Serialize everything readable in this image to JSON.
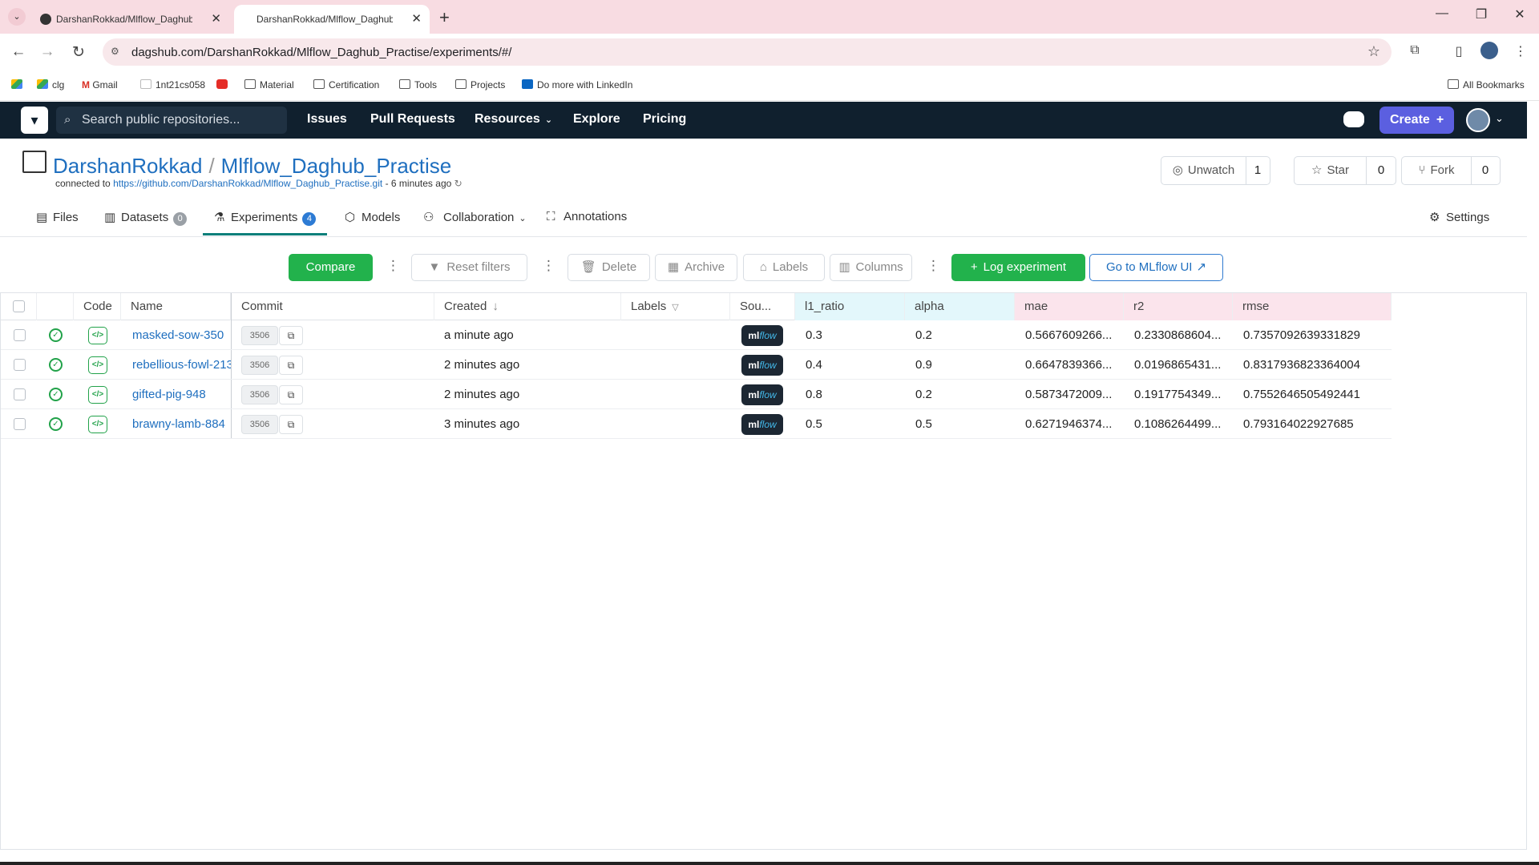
{
  "browser": {
    "tabs": [
      {
        "title": "DarshanRokkad/Mlflow_Daghub_P",
        "active": false
      },
      {
        "title": "DarshanRokkad/Mlflow_Daghub_P",
        "active": true
      }
    ],
    "url": "dagshub.com/DarshanRokkad/Mlflow_Daghub_Practise/experiments/#/",
    "bookmarks": [
      {
        "label": "",
        "icon": "drive-icon"
      },
      {
        "label": "clg",
        "icon": "drive-icon"
      },
      {
        "label": "Gmail",
        "icon": "gmail-icon"
      },
      {
        "label": "1nt21cs058",
        "icon": "bookmark-icon"
      },
      {
        "label": "",
        "icon": "youtube-icon"
      },
      {
        "label": "Material",
        "icon": "folder-icon"
      },
      {
        "label": "Certification",
        "icon": "folder-icon"
      },
      {
        "label": "Tools",
        "icon": "folder-icon"
      },
      {
        "label": "Projects",
        "icon": "folder-icon"
      },
      {
        "label": "Do more with LinkedIn",
        "icon": "linkedin-icon"
      }
    ],
    "all_bookmarks": "All Bookmarks"
  },
  "dagshub": {
    "search_placeholder": "Search public repositories...",
    "nav": [
      "Issues",
      "Pull Requests",
      "Resources",
      "Explore",
      "Pricing"
    ],
    "create_label": "Create"
  },
  "repo": {
    "owner": "DarshanRokkad",
    "name": "Mlflow_Daghub_Practise",
    "connected_prefix": "connected to",
    "connected_url": "https://github.com/DarshanRokkad/Mlflow_Daghub_Practise.git",
    "connected_time": "- 6 minutes ago",
    "watch": {
      "label": "Unwatch",
      "count": "1"
    },
    "star": {
      "label": "Star",
      "count": "0"
    },
    "fork": {
      "label": "Fork",
      "count": "0"
    },
    "tabs": [
      {
        "label": "Files",
        "icon": "file-icon",
        "badge": ""
      },
      {
        "label": "Datasets",
        "icon": "database-icon",
        "badge": "0"
      },
      {
        "label": "Experiments",
        "icon": "flask-icon",
        "badge": "4"
      },
      {
        "label": "Models",
        "icon": "cube-icon",
        "badge": ""
      },
      {
        "label": "Collaboration",
        "icon": "people-icon",
        "badge": ""
      },
      {
        "label": "Annotations",
        "icon": "annotation-icon",
        "badge": ""
      }
    ],
    "settings_label": "Settings"
  },
  "toolbar": {
    "compare": "Compare",
    "reset_filters": "Reset filters",
    "delete": "Delete",
    "archive": "Archive",
    "labels": "Labels",
    "columns": "Columns",
    "log_experiment": "Log experiment",
    "go_to_mlflow": "Go to MLflow UI"
  },
  "table": {
    "columns": {
      "code": "Code",
      "name": "Name",
      "commit": "Commit",
      "created": "Created",
      "labels": "Labels",
      "source": "Sou...",
      "l1_ratio": "l1_ratio",
      "alpha": "alpha",
      "mae": "mae",
      "r2": "r2",
      "rmse": "rmse"
    },
    "rows": [
      {
        "name": "masked-sow-350",
        "commit": "3506",
        "created": "a minute ago",
        "source": "mlflow",
        "l1_ratio": "0.3",
        "alpha": "0.2",
        "mae": "0.5667609266...",
        "r2": "0.2330868604...",
        "rmse": "0.7357092639331829"
      },
      {
        "name": "rebellious-fowl-213",
        "commit": "3506",
        "created": "2 minutes ago",
        "source": "mlflow",
        "l1_ratio": "0.4",
        "alpha": "0.9",
        "mae": "0.6647839366...",
        "r2": "0.0196865431...",
        "rmse": "0.8317936823364004"
      },
      {
        "name": "gifted-pig-948",
        "commit": "3506",
        "created": "2 minutes ago",
        "source": "mlflow",
        "l1_ratio": "0.8",
        "alpha": "0.2",
        "mae": "0.5873472009...",
        "r2": "0.1917754349...",
        "rmse": "0.7552646505492441"
      },
      {
        "name": "brawny-lamb-884",
        "commit": "3506",
        "created": "3 minutes ago",
        "source": "mlflow",
        "l1_ratio": "0.5",
        "alpha": "0.5",
        "mae": "0.6271946374...",
        "r2": "0.1086264499...",
        "rmse": "0.793164022927685"
      }
    ]
  },
  "colors": {
    "dagshub_header": "#10202e",
    "accent_green": "#22b24c",
    "link_blue": "#1f6fbf",
    "create_purple": "#5b5fe0",
    "param_header": "#e3f7fb",
    "metric_header": "#fbe4ec"
  }
}
